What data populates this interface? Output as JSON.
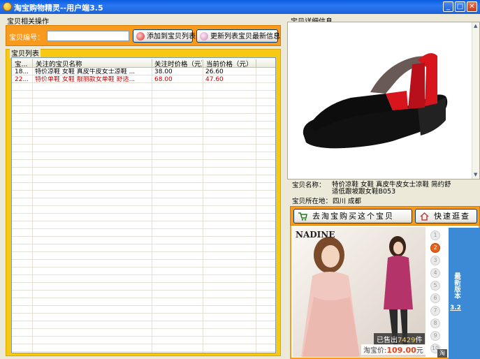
{
  "window": {
    "title": "淘宝购物精灵--用户端3.5",
    "minimize": "_",
    "maximize": "□",
    "close": "✕"
  },
  "item_ops": {
    "group_title": "宝贝相关操作",
    "id_label": "宝贝编号：",
    "id_value": "",
    "add_button": "添加到宝贝列表",
    "refresh_button": "更新列表宝贝最新信息"
  },
  "item_list": {
    "group_title": "宝贝列表",
    "columns": [
      "宝...",
      "关注的宝贝名称",
      "关注时价格（元）",
      "当前价格（元）"
    ],
    "rows": [
      {
        "id": "18...",
        "name": "特价凉鞋 女鞋 真皮牛皮女士凉鞋 ...",
        "watch_price": "38.00",
        "current_price": "26.60",
        "color": "#000000"
      },
      {
        "id": "22...",
        "name": "特价单鞋 女鞋 靓丽款女单鞋 舒适...",
        "watch_price": "68.00",
        "current_price": "47.60",
        "color": "#cc0000"
      }
    ]
  },
  "detail": {
    "group_title": "宝贝详细信息",
    "name_label": "宝贝名称：",
    "name_line1": "特价凉鞋 女鞋 真皮牛皮女士凉鞋 简约舒",
    "name_line2": "适低跟坡跟女鞋B053",
    "location_label": "宝贝所在地：",
    "location_value": "四川  成都",
    "buy_button": "去淘宝购买这个宝贝",
    "quick_button": "快速逛查"
  },
  "ad": {
    "brand": "NADINE",
    "sold_prefix": "已售出",
    "sold_count": "7429",
    "sold_suffix": "件",
    "price_prefix": "淘宝价:",
    "price_value": "109.00",
    "price_suffix": "元",
    "numbers": [
      "1",
      "2",
      "3",
      "4",
      "5",
      "6",
      "7",
      "8",
      "9",
      "10"
    ],
    "active_index": 2,
    "latest_label": "最新版本",
    "version": "3.2",
    "taobao_badge": "淘"
  },
  "colors": {
    "orange": "#f79a1e",
    "yellow": "#f7c913",
    "titlebar": "#0a5ee0",
    "shoe_red": "#d8141c"
  }
}
